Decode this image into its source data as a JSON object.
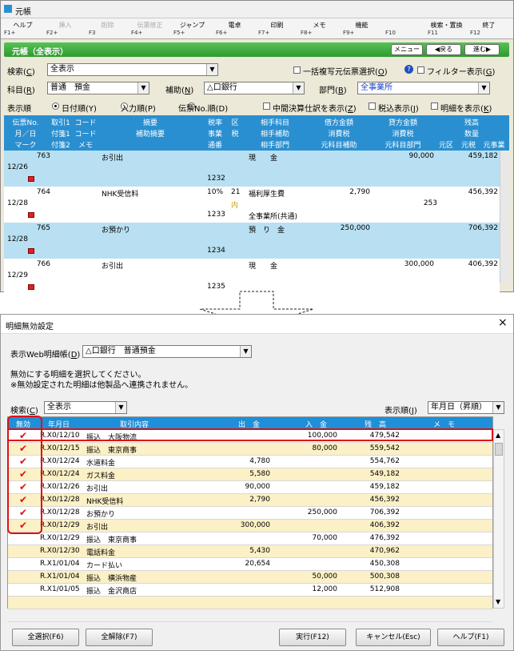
{
  "ledger": {
    "window_title": "元帳",
    "fkeys": [
      {
        "label": "ヘルプ",
        "key": "F1+",
        "disabled": false
      },
      {
        "label": "挿入",
        "key": "F2+",
        "disabled": true
      },
      {
        "label": "削除",
        "key": "F3",
        "disabled": true
      },
      {
        "label": "伝票修正",
        "key": "F4+",
        "disabled": true
      },
      {
        "label": "ジャンプ",
        "key": "F5+",
        "disabled": false
      },
      {
        "label": "電卓",
        "key": "F6+",
        "disabled": false
      },
      {
        "label": "印刷",
        "key": "F7+",
        "disabled": false
      },
      {
        "label": "メモ",
        "key": "F8+",
        "disabled": false
      },
      {
        "label": "機能",
        "key": "F9+",
        "disabled": false
      },
      {
        "label": "",
        "key": "F10",
        "disabled": false
      },
      {
        "label": "検索・置換",
        "key": "F11",
        "disabled": false
      },
      {
        "label": "終了",
        "key": "F12",
        "disabled": false
      }
    ],
    "header_title": "元帳（全表示）",
    "menu_btn": "メニュー",
    "back_btn": "◀戻る",
    "next_btn": "進む▶",
    "search_label": "検索(",
    "search_key": "C",
    "search_label_end": ")",
    "search_value": "全表示",
    "bulk_copy_label": "一括複写元伝票選択(",
    "bulk_copy_key": "O",
    "bulk_copy_label_end": ")",
    "help_badge": "?",
    "filter_label": "フィルター表示(",
    "filter_key": "G",
    "filter_label_end": ")",
    "account_label": "科目(",
    "account_key": "R",
    "account_label_end": ")",
    "account_value": "普通　預金",
    "sub_label": "補助(",
    "sub_key": "N",
    "sub_label_end": ")",
    "sub_value": "△口銀行",
    "dept_label": "部門(",
    "dept_key": "B",
    "dept_label_end": ")",
    "dept_value": "全事業所",
    "order_label": "表示順",
    "order_date": "日付順(Y)",
    "order_input": "入力順(P)",
    "order_slip": "伝票No.順(D)",
    "interim_label": "中間決算仕訳を表示(",
    "interim_key": "Z",
    "interim_label_end": ")",
    "tax_label": "税込表示(",
    "tax_key": "J",
    "tax_label_end": ")",
    "detail_label": "明細を表示(",
    "detail_key": "K",
    "detail_label_end": ")",
    "col_headers": {
      "slip_no": "伝票No.",
      "date": "月／日",
      "mark": "マーク",
      "ref1": "取引1",
      "ref_fuzzy1": "付箋1",
      "ref_fuzzy2": "付箋2",
      "code1": "コード",
      "code2": "コード",
      "memo": "メモ",
      "summary": "摘要",
      "sub_summary": "補助摘要",
      "tax_rate": "税率",
      "business": "事業",
      "voucher": "通番",
      "ku": "区",
      "zei": "税",
      "counter_acct": "相手科目",
      "counter_sub": "相手補助",
      "counter_dept": "相手部門",
      "debit": "借方金額",
      "credit": "貸方金額",
      "tax1": "消費税",
      "tax2": "消費税",
      "orig1": "元科目補助",
      "orig2": "元科目部門",
      "balance": "残高",
      "qty": "数量",
      "motoku": "元区",
      "motozei": "元税",
      "motojig": "元事業"
    },
    "rows": [
      {
        "no": "763",
        "date": "12/26",
        "summary": "お引出",
        "acct": "現　　金",
        "debit": "",
        "credit": "90,000",
        "balance": "459,182",
        "voucher": "1232",
        "rate": "",
        "ku": "",
        "tax": "",
        "dept": "",
        "ku2": ""
      },
      {
        "no": "764",
        "date": "12/28",
        "summary": "NHK受信料",
        "acct": "福利厚生費",
        "debit": "2,790",
        "credit": "",
        "balance": "456,392",
        "voucher": "1233",
        "rate": "10%",
        "ku": "21",
        "tax": "253",
        "dept": "全事業所(共通)",
        "ku2": "内"
      },
      {
        "no": "765",
        "date": "12/28",
        "summary": "お預かり",
        "acct": "預　り　金",
        "debit": "250,000",
        "credit": "",
        "balance": "706,392",
        "voucher": "1234",
        "rate": "",
        "ku": "",
        "tax": "",
        "dept": "",
        "ku2": ""
      },
      {
        "no": "766",
        "date": "12/29",
        "summary": "お引出",
        "acct": "現　　金",
        "debit": "",
        "credit": "300,000",
        "balance": "406,392",
        "voucher": "1235",
        "rate": "",
        "ku": "",
        "tax": "",
        "dept": "",
        "ku2": ""
      }
    ]
  },
  "dialog": {
    "title": "明細無効設定",
    "close": "×",
    "webbook_label": "表示Web明細帳(",
    "webbook_key": "D",
    "webbook_label_end": ")",
    "webbook_value": "△口銀行　普通預金",
    "info1": "無効にする明細を選択してください。",
    "info2": "※無効設定された明細は他製品へ連携されません。",
    "search_label": "検索(",
    "search_key": "C",
    "search_label_end": ")",
    "search_value": "全表示",
    "order_label": "表示順(",
    "order_key": "J",
    "order_label_end": ")",
    "order_value": "年月日（昇順）",
    "headers": {
      "invalid": "無効",
      "date": "年月日",
      "content": "取引内容",
      "out": "出　金",
      "in": "入　金",
      "balance": "残　高",
      "memo": "メ　モ"
    },
    "rows": [
      {
        "checked": true,
        "date": "R.X0/12/10",
        "content": "振込　大阪物流",
        "out": "",
        "in": "100,000",
        "balance": "479,542"
      },
      {
        "checked": true,
        "date": "R.X0/12/15",
        "content": "振込　東京商事",
        "out": "",
        "in": "80,000",
        "balance": "559,542"
      },
      {
        "checked": true,
        "date": "R.X0/12/24",
        "content": "水道料金",
        "out": "4,780",
        "in": "",
        "balance": "554,762"
      },
      {
        "checked": true,
        "date": "R.X0/12/24",
        "content": "ガス料金",
        "out": "5,580",
        "in": "",
        "balance": "549,182"
      },
      {
        "checked": true,
        "date": "R.X0/12/26",
        "content": "お引出",
        "out": "90,000",
        "in": "",
        "balance": "459,182"
      },
      {
        "checked": true,
        "date": "R.X0/12/28",
        "content": "NHK受信料",
        "out": "2,790",
        "in": "",
        "balance": "456,392"
      },
      {
        "checked": true,
        "date": "R.X0/12/28",
        "content": "お預かり",
        "out": "",
        "in": "250,000",
        "balance": "706,392"
      },
      {
        "checked": true,
        "date": "R.X0/12/29",
        "content": "お引出",
        "out": "300,000",
        "in": "",
        "balance": "406,392"
      },
      {
        "checked": false,
        "date": "R.X0/12/29",
        "content": "振込　東京商事",
        "out": "",
        "in": "70,000",
        "balance": "476,392"
      },
      {
        "checked": false,
        "date": "R.X0/12/30",
        "content": "電話料金",
        "out": "5,430",
        "in": "",
        "balance": "470,962"
      },
      {
        "checked": false,
        "date": "R.X1/01/04",
        "content": "カード払い",
        "out": "20,654",
        "in": "",
        "balance": "450,308"
      },
      {
        "checked": false,
        "date": "R.X1/01/04",
        "content": "振込　横浜物産",
        "out": "",
        "in": "50,000",
        "balance": "500,308"
      },
      {
        "checked": false,
        "date": "R.X1/01/05",
        "content": "振込　金沢商店",
        "out": "",
        "in": "12,000",
        "balance": "512,908"
      }
    ],
    "btn_select_all": "全選択(F6)",
    "btn_clear_all": "全解除(F7)",
    "btn_execute": "実行(F12)",
    "btn_cancel": "キャンセル(Esc)",
    "btn_help": "ヘルプ(F1)"
  },
  "colors": {
    "green": "#3aa83a",
    "blue_header": "#2a8fd0",
    "highlight_red": "#e01010",
    "row_blue": "#b8e0f2",
    "row_yellow": "#fbf0c6"
  }
}
